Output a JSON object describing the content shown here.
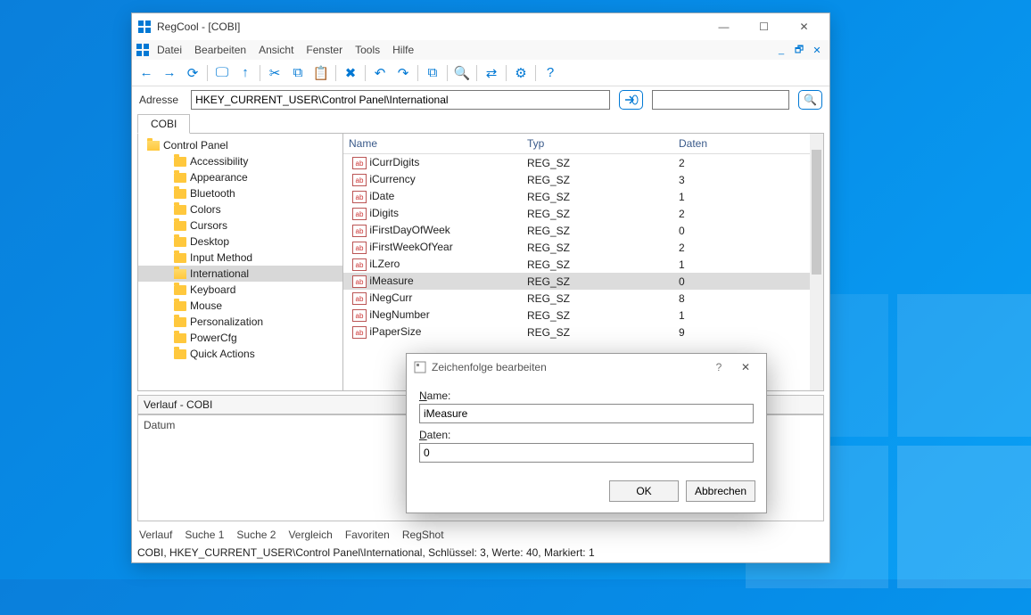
{
  "window": {
    "title": "RegCool - [COBI]"
  },
  "menu": {
    "items": [
      "Datei",
      "Bearbeiten",
      "Ansicht",
      "Fenster",
      "Tools",
      "Hilfe"
    ]
  },
  "address": {
    "label": "Adresse",
    "value": "HKEY_CURRENT_USER\\Control Panel\\International"
  },
  "tabs": {
    "main": "COBI"
  },
  "tree": {
    "parent": "Control Panel",
    "children": [
      "Accessibility",
      "Appearance",
      "Bluetooth",
      "Colors",
      "Cursors",
      "Desktop",
      "Input Method",
      "International",
      "Keyboard",
      "Mouse",
      "Personalization",
      "PowerCfg",
      "Quick Actions"
    ],
    "selected": "International"
  },
  "list": {
    "headers": {
      "name": "Name",
      "type": "Typ",
      "data": "Daten"
    },
    "rows": [
      {
        "name": "iCurrDigits",
        "type": "REG_SZ",
        "data": "2"
      },
      {
        "name": "iCurrency",
        "type": "REG_SZ",
        "data": "3"
      },
      {
        "name": "iDate",
        "type": "REG_SZ",
        "data": "1"
      },
      {
        "name": "iDigits",
        "type": "REG_SZ",
        "data": "2"
      },
      {
        "name": "iFirstDayOfWeek",
        "type": "REG_SZ",
        "data": "0"
      },
      {
        "name": "iFirstWeekOfYear",
        "type": "REG_SZ",
        "data": "2"
      },
      {
        "name": "iLZero",
        "type": "REG_SZ",
        "data": "1"
      },
      {
        "name": "iMeasure",
        "type": "REG_SZ",
        "data": "0"
      },
      {
        "name": "iNegCurr",
        "type": "REG_SZ",
        "data": "8"
      },
      {
        "name": "iNegNumber",
        "type": "REG_SZ",
        "data": "1"
      },
      {
        "name": "iPaperSize",
        "type": "REG_SZ",
        "data": "9"
      }
    ],
    "selected": "iMeasure"
  },
  "history": {
    "title": "Verlauf - COBI",
    "col": "Datum"
  },
  "bottomTabs": [
    "Verlauf",
    "Suche 1",
    "Suche 2",
    "Vergleich",
    "Favoriten",
    "RegShot"
  ],
  "statusbar": "COBI, HKEY_CURRENT_USER\\Control Panel\\International, Schlüssel: 3, Werte: 40, Markiert: 1",
  "dialog": {
    "title": "Zeichenfolge bearbeiten",
    "nameLabel": "Name:",
    "nameValue": "iMeasure",
    "dataLabel": "Daten:",
    "dataValue": "0",
    "ok": "OK",
    "cancel": "Abbrechen"
  }
}
